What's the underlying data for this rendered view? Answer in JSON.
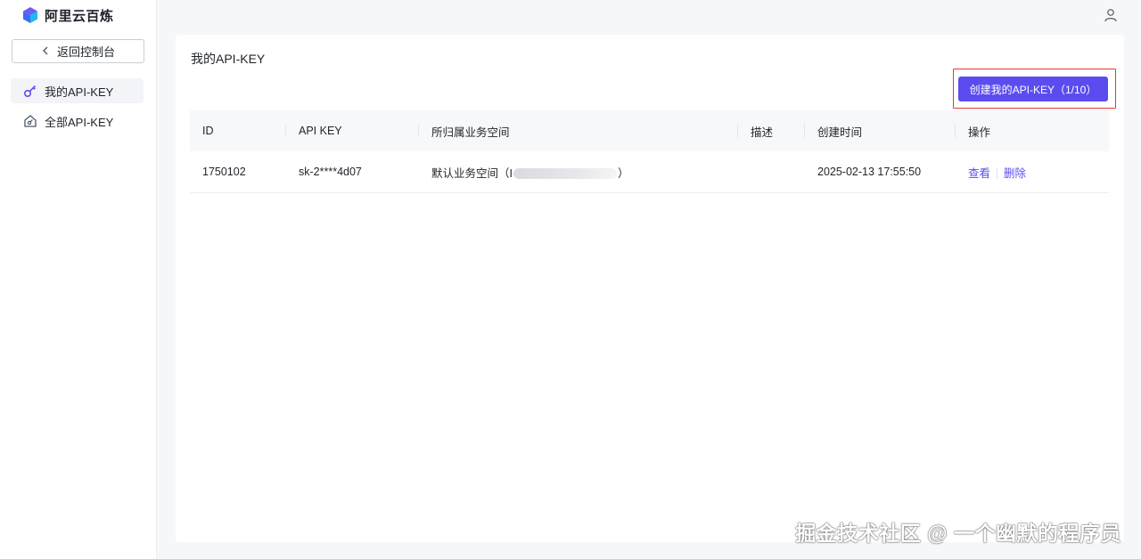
{
  "app": {
    "logo_text": "阿里云百炼"
  },
  "sidebar": {
    "back_label": "返回控制台",
    "items": [
      {
        "label": "我的API-KEY",
        "active": true
      },
      {
        "label": "全部API-KEY",
        "active": false
      }
    ]
  },
  "main": {
    "title": "我的API-KEY",
    "create_button": "创建我的API-KEY（1/10）",
    "table": {
      "headers": [
        "ID",
        "API KEY",
        "所归属业务空间",
        "描述",
        "创建时间",
        "操作"
      ],
      "rows": [
        {
          "id": "1750102",
          "api_key": "sk-2****4d07",
          "space_prefix": "默认业务空间（I",
          "space_suffix": "）",
          "description": "",
          "created": "2025-02-13 17:55:50",
          "action_view": "查看",
          "action_delete": "删除"
        }
      ]
    }
  },
  "watermark": "掘金技术社区 @ 一个幽默的程序员",
  "colors": {
    "accent": "#5b4cf0",
    "highlight_border": "#e53935"
  }
}
